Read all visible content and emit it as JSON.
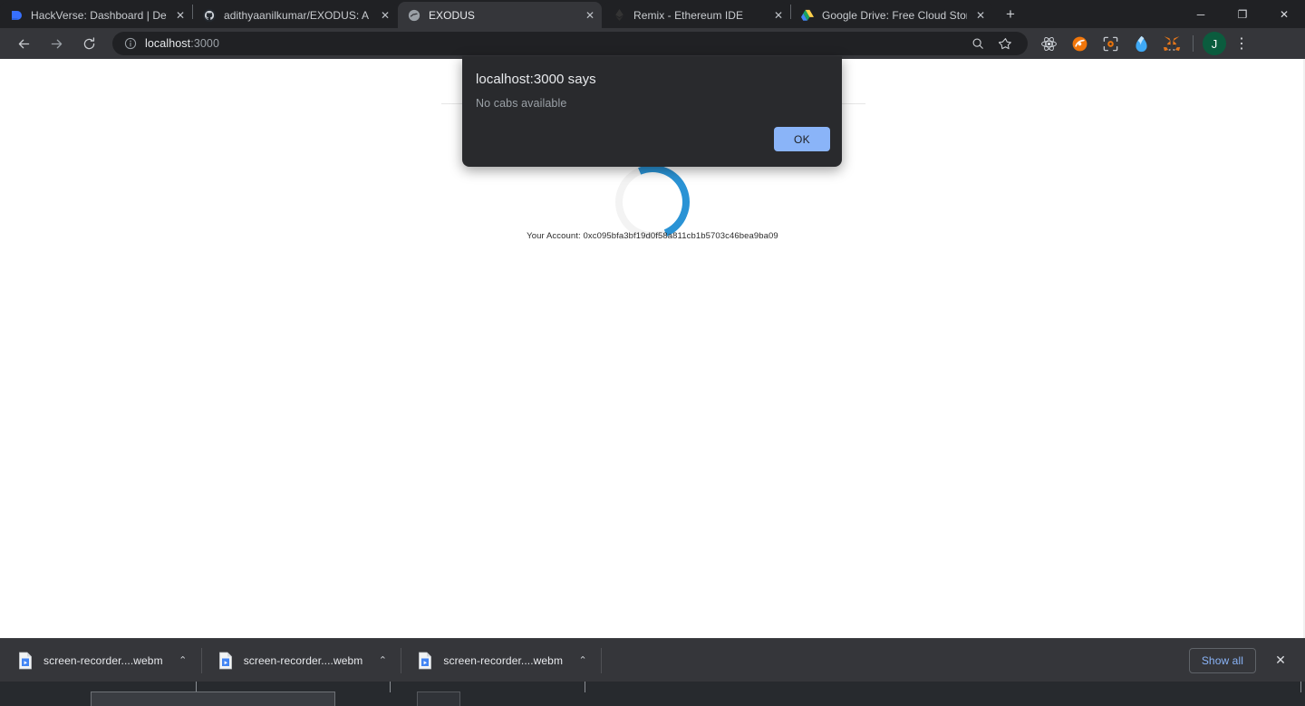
{
  "browser": {
    "tabs": [
      {
        "title": "HackVerse: Dashboard | Devfolio",
        "favicon": "devfolio-icon",
        "active": false,
        "close_label": "✕"
      },
      {
        "title": "adithyaanilkumar/EXODUS: A Blo",
        "favicon": "github-icon",
        "active": false,
        "close_label": "✕"
      },
      {
        "title": "EXODUS",
        "favicon": "exodus-globe-icon",
        "active": true,
        "close_label": "✕"
      },
      {
        "title": "Remix - Ethereum IDE",
        "favicon": "ethereum-icon",
        "active": false,
        "close_label": "✕"
      },
      {
        "title": "Google Drive: Free Cloud Storage",
        "favicon": "google-drive-icon",
        "active": false,
        "close_label": "✕"
      }
    ],
    "new_tab_label": "+",
    "window_controls": {
      "minimize": "─",
      "maximize": "❐",
      "close": "✕"
    },
    "toolbar": {
      "back_label": "←",
      "forward_label": "→",
      "reload_label": "⟳",
      "site_info_icon": "info-circle-icon",
      "url_host": "localhost",
      "url_port": ":3000",
      "url_full": "localhost:3000",
      "search_in_page_icon": "search-icon",
      "bookmark_icon": "star-icon",
      "extensions": [
        {
          "name": "react-devtools-icon",
          "color": "#d8dde3"
        },
        {
          "name": "hardhat-extension-icon",
          "color": "#f1760a"
        },
        {
          "name": "scanner-extension-icon",
          "color": "#e8730c"
        },
        {
          "name": "phantom-wallet-icon",
          "color": "#3fa9f5"
        },
        {
          "name": "metamask-fox-icon",
          "color": "#e2761b"
        }
      ],
      "profile_initial": "J",
      "menu_label": "⋮"
    }
  },
  "page": {
    "account_label": "Your Account:",
    "account_address": "0xc095bfa3bf19d0f58a811cb1b5703c46bea9ba09",
    "spinner_name": "loading-spinner",
    "spinner_track_color": "#f3f3f3",
    "spinner_accent_color": "#2a93d5",
    "background_color": "#ffffff"
  },
  "dialog": {
    "title": "localhost:3000 says",
    "message": "No cabs available",
    "ok_label": "OK",
    "background_color": "#292a2d",
    "button_color": "#8ab4f8"
  },
  "downloads": {
    "items": [
      {
        "filename": "screen-recorder....webm",
        "caret": "⌃",
        "icon": "video-file-icon"
      },
      {
        "filename": "screen-recorder....webm",
        "caret": "⌃",
        "icon": "video-file-icon"
      },
      {
        "filename": "screen-recorder....webm",
        "caret": "⌃",
        "icon": "video-file-icon"
      }
    ],
    "show_all_label": "Show all",
    "close_label": "✕"
  },
  "taskbar": {
    "clock": ""
  }
}
